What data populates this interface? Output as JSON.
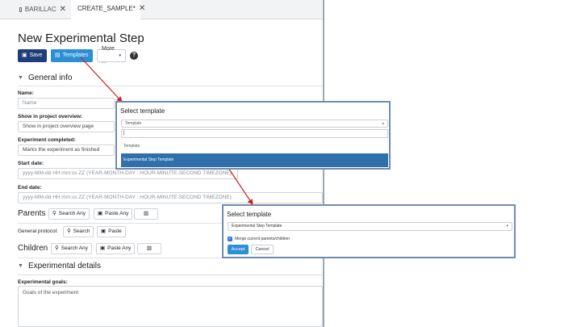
{
  "tabs": [
    {
      "label": "BARILLAC",
      "close": "✕"
    },
    {
      "label": "CREATE_SAMPLE*",
      "close": "✕"
    }
  ],
  "page_title": "New Experimental Step",
  "toolbar": {
    "save_label": "Save",
    "templates_label": "Templates",
    "more_label": "More ...",
    "help_label": "?"
  },
  "general": {
    "section_title": "General info",
    "name_label": "Name:",
    "name_placeholder": "Name",
    "show_label": "Show in project overview:",
    "show_value": "Show in project overview page",
    "completed_label": "Experiment completed:",
    "completed_value": "Marks the experiment as finished",
    "start_label": "Start date:",
    "start_placeholder": "yyyy-MM-dd HH:mm:ss ZZ (YEAR-MONTH-DAY : HOUR-MINUTE-SECOND TIMEZONE)",
    "end_label": "End date:",
    "end_placeholder": "yyyy-MM-dd HH:mm:ss ZZ (YEAR-MONTH-DAY : HOUR-MINUTE-SECOND TIMEZONE)"
  },
  "parents": {
    "label": "Parents",
    "search": "Search Any",
    "paste": "Paste Any"
  },
  "protocol": {
    "label": "General protocol:",
    "search": "Search",
    "paste": "Paste"
  },
  "children": {
    "label": "Children",
    "search": "Search Any",
    "paste": "Paste Any"
  },
  "details": {
    "section_title": "Experimental details",
    "goals_label": "Experimental goals:",
    "goals_placeholder": "Goals of the experiment"
  },
  "dialog1": {
    "title": "Select template",
    "select_value": "Template",
    "search_value": "|",
    "options": [
      "Template",
      "Experimental Step Template"
    ]
  },
  "dialog2": {
    "title": "Select template",
    "select_value": "Experimental Step Template",
    "checkbox_label": "Merge current parents/children",
    "accept_label": "Accept",
    "cancel_label": "Cancel"
  },
  "colors": {
    "primary_dark": "#1f3d7a",
    "primary": "#2b8fd6",
    "selected": "#2f6faa",
    "arrow": "#d21f1f"
  }
}
